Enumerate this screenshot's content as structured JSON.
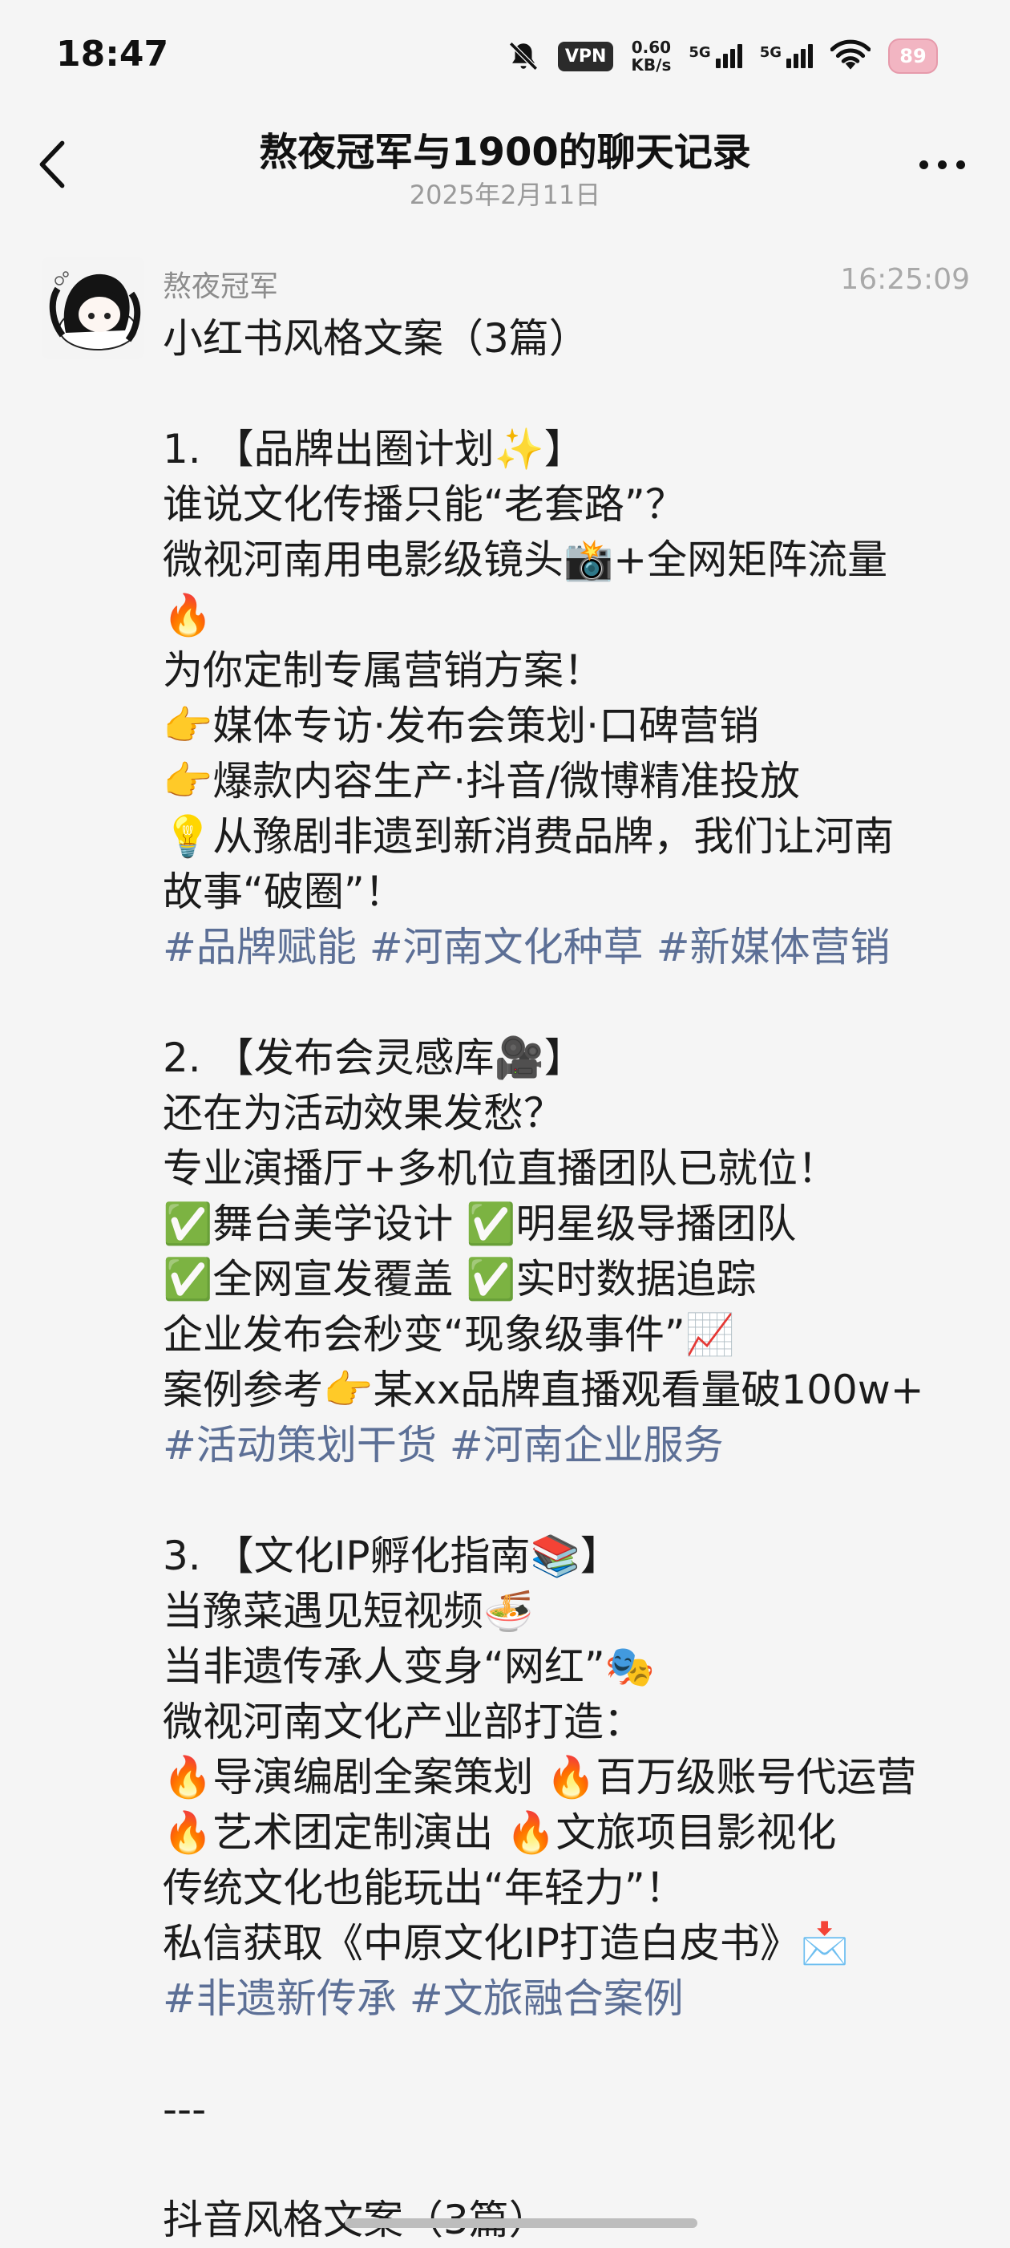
{
  "status_bar": {
    "time": "18:47",
    "vpn": "VPN",
    "speed_value": "0.60",
    "speed_unit": "KB/s",
    "net1": "5G",
    "net2": "5G",
    "battery": "89"
  },
  "nav": {
    "title": "熬夜冠军与1900的聊天记录",
    "subtitle": "2025年2月11日"
  },
  "message": {
    "sender": "熬夜冠军",
    "timestamp": "16:25:09",
    "lines": [
      "小红书风格文案（3篇）",
      "",
      "1. 【品牌出圈计划✨】",
      "谁说文化传播只能“老套路”？",
      "微视河南用电影级镜头📸+全网矩阵流量",
      "🔥",
      "为你定制专属营销方案！",
      "👉媒体专访·发布会策划·口碑营销",
      "👉爆款内容生产·抖音/微博精准投放",
      "💡从豫剧非遗到新消费品牌，我们让河南",
      "故事“破圈”！",
      "#品牌赋能 #河南文化种草 #新媒体营销",
      "",
      "2. 【发布会灵感库🎥】",
      "还在为活动效果发愁？",
      "专业演播厅+多机位直播团队已就位！",
      "✅舞台美学设计 ✅明星级导播团队",
      "✅全网宣发覆盖 ✅实时数据追踪",
      "企业发布会秒变“现象级事件”📈",
      "案例参考👉某xx品牌直播观看量破100w+",
      "#活动策划干货 #河南企业服务",
      "",
      "3. 【文化IP孵化指南📚】",
      "当豫菜遇见短视频🍜",
      "当非遗传承人变身“网红”🎭",
      "微视河南文化产业部打造：",
      "🔥导演编剧全案策划 🔥百万级账号代运营",
      "🔥艺术团定制演出 🔥文旅项目影视化",
      "传统文化也能玩出“年轻力”！",
      "私信获取《中原文化IP打造白皮书》📩",
      "#非遗新传承 #文旅融合案例",
      "",
      "---",
      "",
      "抖音风格文案（3篇）"
    ]
  },
  "icons": {
    "back": "chevron-left-icon",
    "more": "more-dots-icon",
    "mute": "bell-off-icon",
    "wifi": "wifi-icon"
  },
  "colors": {
    "background": "#f5f5f5",
    "hashtag": "#5c6f96",
    "secondary_text": "#8c8c8c"
  }
}
